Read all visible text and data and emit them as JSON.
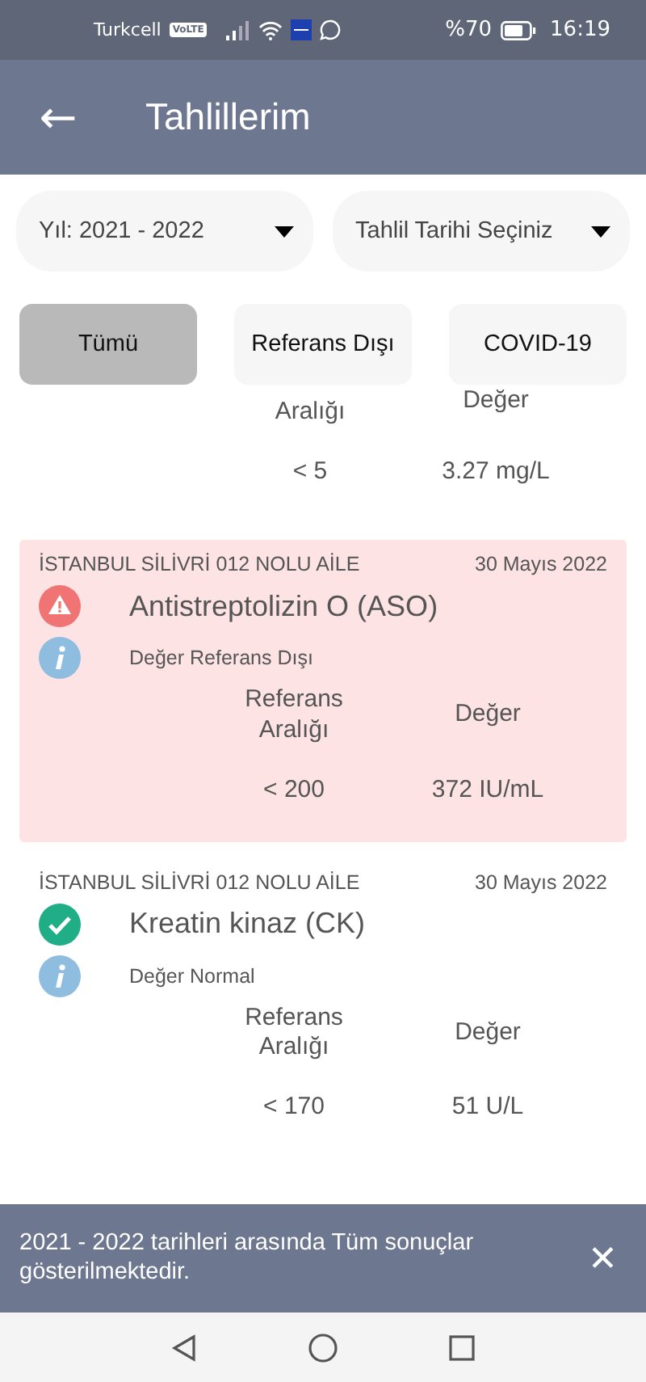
{
  "status_bar": {
    "carrier": "Turkcell",
    "volte": "VoLTE",
    "battery_text": "%70",
    "time": "16:19"
  },
  "app_bar": {
    "back": "←",
    "title": "Tahlillerim"
  },
  "dropdowns": [
    {
      "value": "Yıl: 2021 - 2022"
    },
    {
      "value": "Tahlil Tarihi Seçiniz"
    }
  ],
  "chips": [
    {
      "label": "Tümü",
      "selected": true
    },
    {
      "label": "Referans Dışı",
      "selected": false
    },
    {
      "label": "COVID-19",
      "selected": false
    }
  ],
  "partial_result": {
    "ref_label": "Aralığı",
    "value_label": "Değer",
    "ref": "< 5",
    "value": "3.27 mg/L"
  },
  "results": [
    {
      "lab": "İSTANBUL SİLİVRİ 012 NOLU AİLE",
      "date": "30 Mayıs 2022",
      "out_of_range": true,
      "name": "Antistreptolizin O (ASO)",
      "note": "Değer Referans Dışı",
      "ref_label": "Referans Aralığı",
      "value_label": "Değer",
      "ref": "< 200",
      "value": "372 IU/mL"
    },
    {
      "lab": "İSTANBUL SİLİVRİ 012 NOLU AİLE",
      "date": "30 Mayıs 2022",
      "out_of_range": false,
      "name": "Kreatin kinaz (CK)",
      "note": "Değer Normal",
      "ref_label": "Referans Aralığı",
      "value_label": "Değer",
      "ref": "< 170",
      "value": "51 U/L"
    }
  ],
  "snackbar": {
    "message": "2021 - 2022 tarihleri arasında Tüm sonuçlar gösterilmektedir.",
    "close": "✕"
  }
}
